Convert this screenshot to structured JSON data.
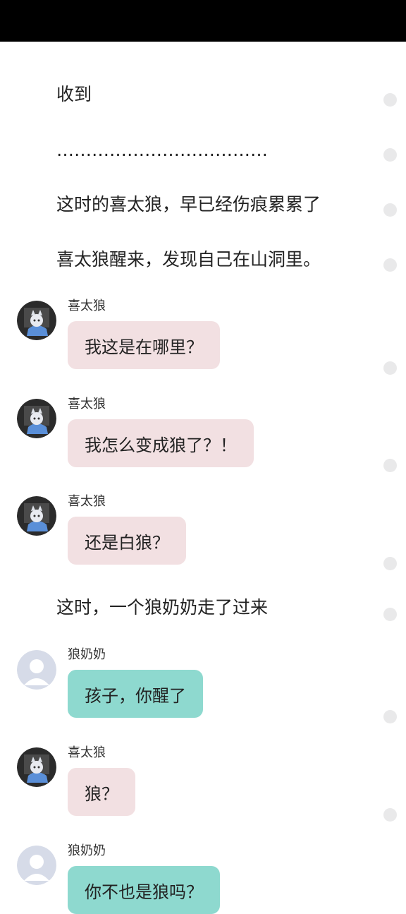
{
  "colors": {
    "status_bar": "#000000",
    "bubble_pink": "#f2e0e2",
    "bubble_teal": "#8ed9cf",
    "dot": "#e9e9ea"
  },
  "narration": [
    "收到",
    "………………………………",
    "这时的喜太狼，早已经伤痕累累了",
    "喜太狼醒来，发现自己在山洞里。",
    "这时，一个狼奶奶走了过来"
  ],
  "messages": [
    {
      "speaker": "喜太狼",
      "text": "我这是在哪里？",
      "avatar": "wolf-character-avatar"
    },
    {
      "speaker": "喜太狼",
      "text": "我怎么变成狼了？！",
      "avatar": "wolf-character-avatar"
    },
    {
      "speaker": "喜太狼",
      "text": "还是白狼？",
      "avatar": "wolf-character-avatar"
    },
    {
      "speaker": "狼奶奶",
      "text": "孩子，你醒了",
      "avatar": "default-user-avatar"
    },
    {
      "speaker": "喜太狼",
      "text": "狼？",
      "avatar": "wolf-character-avatar"
    },
    {
      "speaker": "狼奶奶",
      "text": "你不也是狼吗？",
      "avatar": "default-user-avatar"
    }
  ]
}
